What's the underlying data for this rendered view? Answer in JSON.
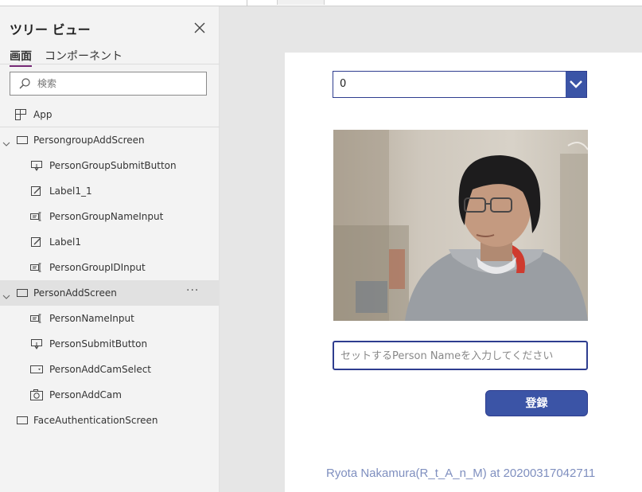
{
  "panel": {
    "title": "ツリー ビュー",
    "tabs": [
      {
        "label": "画面",
        "active": true
      },
      {
        "label": "コンポーネント",
        "active": false
      }
    ],
    "search_placeholder": "検索",
    "app_label": "App",
    "items": [
      {
        "label": "PersongroupAddScreen",
        "icon": "screen-icon",
        "expanded": true
      },
      {
        "label": "PersonGroupSubmitButton",
        "icon": "button-icon"
      },
      {
        "label": "Label1_1",
        "icon": "label-edit-icon"
      },
      {
        "label": "PersonGroupNameInput",
        "icon": "text-input-icon"
      },
      {
        "label": "Label1",
        "icon": "label-edit-icon"
      },
      {
        "label": "PersonGroupIDInput",
        "icon": "text-input-icon"
      },
      {
        "label": "PersonAddScreen",
        "icon": "screen-icon",
        "expanded": true,
        "selected": true,
        "more": "···"
      },
      {
        "label": "PersonNameInput",
        "icon": "text-input-icon"
      },
      {
        "label": "PersonSubmitButton",
        "icon": "button-icon"
      },
      {
        "label": "PersonAddCamSelect",
        "icon": "dropdown-icon"
      },
      {
        "label": "PersonAddCam",
        "icon": "camera-icon"
      },
      {
        "label": "FaceAuthenticationScreen",
        "icon": "screen-icon"
      }
    ]
  },
  "canvas": {
    "dropdown_value": "0",
    "name_input_placeholder": "セットするPerson Nameを入力してください",
    "submit_label": "登録"
  },
  "watermark": "Ryota Nakamura(R_t_A_n_M) at 20200317042711",
  "colors": {
    "accent": "#3b54a6",
    "border_dark": "#2e3d8f",
    "tab_underline": "#742774",
    "selected_row": "#e1e1e1"
  }
}
